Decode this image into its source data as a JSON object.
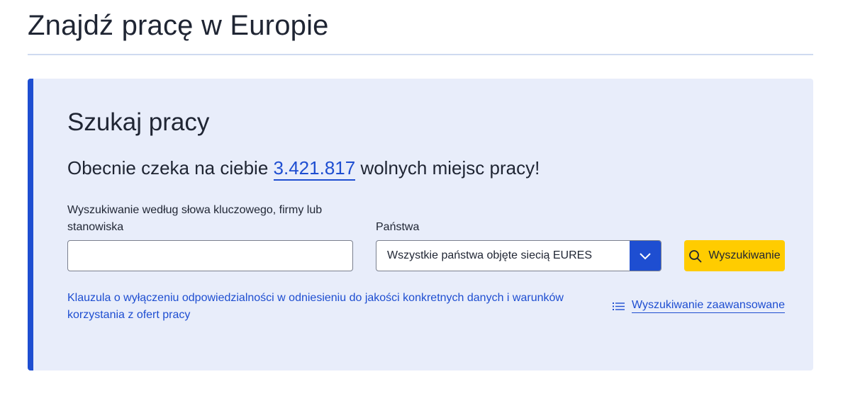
{
  "page": {
    "title": "Znajdź pracę w Europie"
  },
  "search_panel": {
    "title": "Szukaj pracy",
    "counter_prefix": "Obecnie czeka na ciebie",
    "counter_value": "3.421.817",
    "counter_suffix": "wolnych miejsc pracy!",
    "keyword": {
      "label": "Wyszukiwanie według słowa kluczowego, firmy lub stanowiska",
      "value": ""
    },
    "country": {
      "label": "Państwa",
      "selected": "Wszystkie państwa objęte siecią EURES"
    },
    "search_button_label": "Wyszukiwanie",
    "disclaimer_link": "Klauzula o wyłączeniu odpowiedzialności w odniesieniu do jakości konkretnych danych i warunków korzystania z ofert pracy",
    "advanced_search_label": "Wyszukiwanie zaawansowane"
  },
  "colors": {
    "accent": "#1e4ed1",
    "panel_background": "#e8edfa",
    "search_button": "#ffcc00",
    "text": "#1f2533"
  },
  "icons": {
    "search": "search-icon",
    "dropdown": "chevron-down-icon",
    "advanced": "list-icon"
  }
}
